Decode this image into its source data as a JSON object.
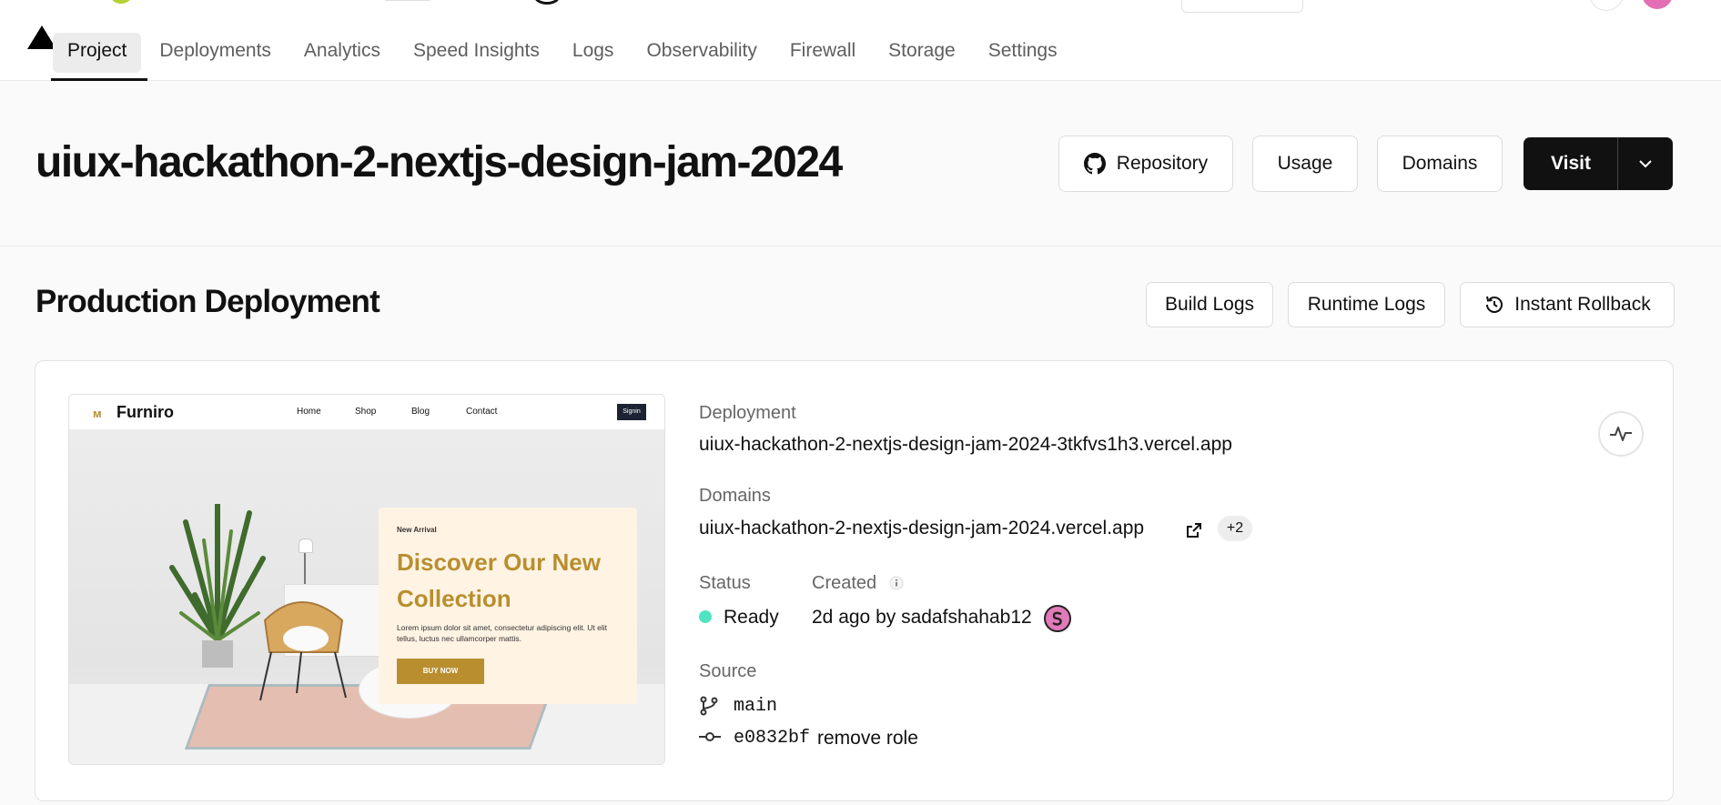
{
  "nav": {
    "tabs": [
      {
        "label": "Project"
      },
      {
        "label": "Deployments"
      },
      {
        "label": "Analytics"
      },
      {
        "label": "Speed Insights"
      },
      {
        "label": "Logs"
      },
      {
        "label": "Observability"
      },
      {
        "label": "Firewall"
      },
      {
        "label": "Storage"
      },
      {
        "label": "Settings"
      }
    ],
    "active_tab": "Project"
  },
  "header": {
    "project_name": "uiux-hackathon-2-nextjs-design-jam-2024",
    "repository_label": "Repository",
    "usage_label": "Usage",
    "domains_label": "Domains",
    "visit_label": "Visit"
  },
  "production": {
    "title": "Production Deployment",
    "build_logs_label": "Build Logs",
    "runtime_logs_label": "Runtime Logs",
    "rollback_label": "Instant Rollback"
  },
  "preview": {
    "brand": "Furniro",
    "nav_links": [
      "Home",
      "Shop",
      "Blog",
      "Contact"
    ],
    "signin": "Signin",
    "eyebrow": "New Arrival",
    "headline": "Discover Our New Collection",
    "body": "Lorem ipsum dolor sit amet, consectetur adipiscing elit. Ut elit tellus, luctus nec ullamcorper mattis.",
    "cta": "BUY NOW"
  },
  "deployment": {
    "deployment_label": "Deployment",
    "deployment_url": "uiux-hackathon-2-nextjs-design-jam-2024-3tkfvs1h3.vercel.app",
    "domains_label": "Domains",
    "domain_url": "uiux-hackathon-2-nextjs-design-jam-2024.vercel.app",
    "extra_domains": "+2",
    "status_label": "Status",
    "status_value": "Ready",
    "created_label": "Created",
    "created_value": "2d ago by sadafshahab12",
    "source_label": "Source",
    "branch": "main",
    "commit_hash": "e0832bf",
    "commit_message": "remove role"
  },
  "colors": {
    "status_ready": "#50e3c2",
    "brand_gold": "#b88e2f",
    "primary_dark": "#111111"
  }
}
